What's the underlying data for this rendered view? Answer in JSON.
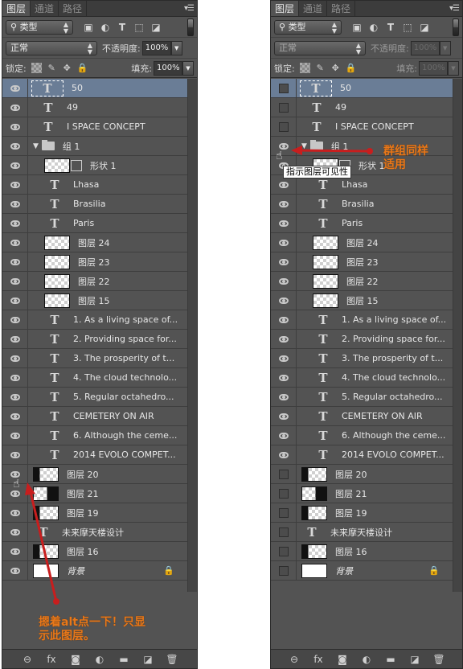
{
  "left_panel": {
    "tabs": [
      "图层",
      "通道",
      "路径"
    ],
    "active_tab": 0,
    "filter": {
      "label": "类型",
      "icons": [
        "image-filter-icon",
        "adjustment-filter-icon",
        "type-filter-icon",
        "shape-filter-icon",
        "smart-object-filter-icon"
      ]
    },
    "blend_mode": "正常",
    "opacity_label": "不透明度:",
    "opacity_value": "100%",
    "lock_label": "锁定:",
    "fill_label": "填充:",
    "fill_value": "100%",
    "annotation": "摁着alt点一下！只显\n示此图层。"
  },
  "right_panel": {
    "tabs": [
      "图层",
      "通道",
      "路径"
    ],
    "active_tab": 0,
    "filter": {
      "label": "类型"
    },
    "blend_mode": "正常",
    "opacity_label": "不透明度:",
    "opacity_value": "100%",
    "lock_label": "锁定:",
    "fill_label": "填充:",
    "fill_value": "100%",
    "tooltip": "指示图层可见性",
    "annotation": "群组同样\n适用"
  },
  "layers": [
    {
      "name": "50",
      "kind": "text",
      "indent": 0,
      "selected": true
    },
    {
      "name": "49",
      "kind": "text",
      "indent": 0
    },
    {
      "name": "I  SPACE CONCEPT",
      "kind": "text",
      "indent": 0
    },
    {
      "name": "组 1",
      "kind": "group",
      "indent": 0
    },
    {
      "name": "形状 1",
      "kind": "shape",
      "indent": 1
    },
    {
      "name": "Lhasa",
      "kind": "text",
      "indent": 1
    },
    {
      "name": "Brasilia",
      "kind": "text",
      "indent": 1
    },
    {
      "name": "Paris",
      "kind": "text",
      "indent": 1
    },
    {
      "name": "图层 24",
      "kind": "pixel",
      "indent": 1
    },
    {
      "name": "图层 23",
      "kind": "pixel",
      "indent": 1
    },
    {
      "name": "图层 22",
      "kind": "pixel",
      "indent": 1
    },
    {
      "name": "图层 15",
      "kind": "pixel",
      "indent": 1
    },
    {
      "name": "1. As a living space of...",
      "kind": "text",
      "indent": 1
    },
    {
      "name": "2. Providing space for...",
      "kind": "text",
      "indent": 1
    },
    {
      "name": "3. The prosperity of t...",
      "kind": "text",
      "indent": 1
    },
    {
      "name": "4. The cloud technolo...",
      "kind": "text",
      "indent": 1
    },
    {
      "name": "5. Regular octahedro...",
      "kind": "text",
      "indent": 1
    },
    {
      "name": "CEMETERY ON AIR",
      "kind": "text",
      "indent": 1
    },
    {
      "name": "6. Although the ceme...",
      "kind": "text",
      "indent": 1
    },
    {
      "name": "2014 EVOLO COMPET...",
      "kind": "text",
      "indent": 1
    },
    {
      "name": "图层 20",
      "kind": "pixel-dark",
      "indent": 0
    },
    {
      "name": "图层 21",
      "kind": "pixel-dark-r",
      "indent": 0
    },
    {
      "name": "图层 19",
      "kind": "pixel-dark",
      "indent": 0
    },
    {
      "name": "未来摩天楼设计",
      "kind": "text",
      "indent": 0
    },
    {
      "name": "图层 16",
      "kind": "pixel-dark",
      "indent": 0
    },
    {
      "name": "背景",
      "kind": "background",
      "indent": 0,
      "locked": true
    }
  ],
  "right_visible_from": 3,
  "right_visible_to": 19,
  "footer_icons": [
    "link-layers-icon",
    "fx-icon",
    "add-mask-icon",
    "adjustment-layer-icon",
    "new-group-icon",
    "new-layer-icon",
    "delete-layer-icon"
  ],
  "footer_glyphs": [
    "⊖",
    "fx",
    "◙",
    "◐",
    "▬",
    "◪",
    "🗑"
  ]
}
